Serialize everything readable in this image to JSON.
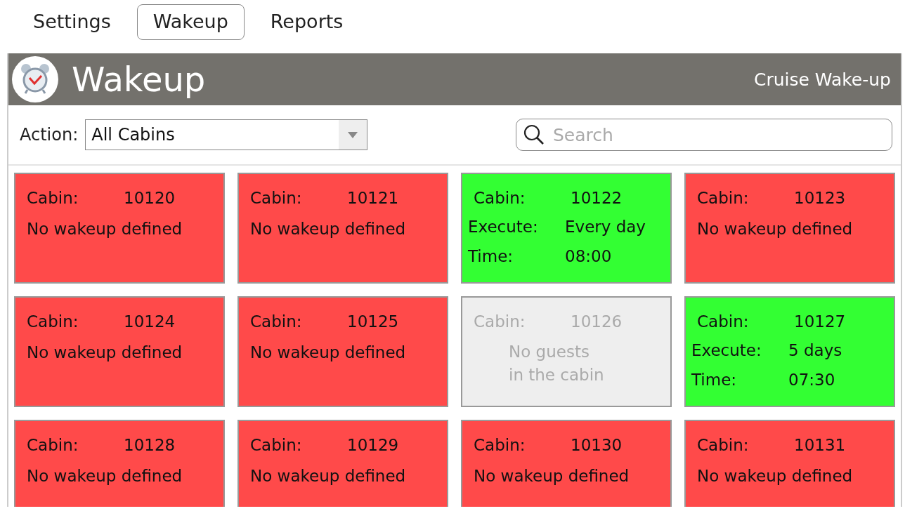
{
  "tabs": [
    {
      "label": "Settings",
      "selected": false
    },
    {
      "label": "Wakeup",
      "selected": true
    },
    {
      "label": "Reports",
      "selected": false
    }
  ],
  "header": {
    "title": "Wakeup",
    "subtitle": "Cruise Wake-up"
  },
  "toolbar": {
    "action_label": "Action:",
    "action_value": "All Cabins",
    "search": {
      "placeholder": "Search"
    }
  },
  "cards": [
    {
      "kind": "none",
      "cabin_label": "Cabin:",
      "cabin": "10120",
      "message": "No wakeup defined"
    },
    {
      "kind": "none",
      "cabin_label": "Cabin:",
      "cabin": "10121",
      "message": "No wakeup defined"
    },
    {
      "kind": "scheduled",
      "cabin_label": "Cabin:",
      "cabin": "10122",
      "rows": [
        {
          "label": "Execute:",
          "value": "Every day"
        },
        {
          "label": "Time:",
          "value": "08:00"
        }
      ]
    },
    {
      "kind": "none",
      "cabin_label": "Cabin:",
      "cabin": "10123",
      "message": "No wakeup defined"
    },
    {
      "kind": "none",
      "cabin_label": "Cabin:",
      "cabin": "10124",
      "message": "No wakeup defined"
    },
    {
      "kind": "none",
      "cabin_label": "Cabin:",
      "cabin": "10125",
      "message": "No wakeup defined"
    },
    {
      "kind": "empty",
      "cabin_label": "Cabin:",
      "cabin": "10126",
      "message": "No guests\nin the cabin"
    },
    {
      "kind": "scheduled",
      "cabin_label": "Cabin:",
      "cabin": "10127",
      "rows": [
        {
          "label": "Execute:",
          "value": "5 days"
        },
        {
          "label": "Time:",
          "value": "07:30"
        }
      ]
    },
    {
      "kind": "none",
      "cabin_label": "Cabin:",
      "cabin": "10128",
      "message": "No wakeup defined"
    },
    {
      "kind": "none",
      "cabin_label": "Cabin:",
      "cabin": "10129",
      "message": "No wakeup defined"
    },
    {
      "kind": "none",
      "cabin_label": "Cabin:",
      "cabin": "10130",
      "message": "No wakeup defined"
    },
    {
      "kind": "none",
      "cabin_label": "Cabin:",
      "cabin": "10131",
      "message": "No wakeup defined"
    }
  ]
}
